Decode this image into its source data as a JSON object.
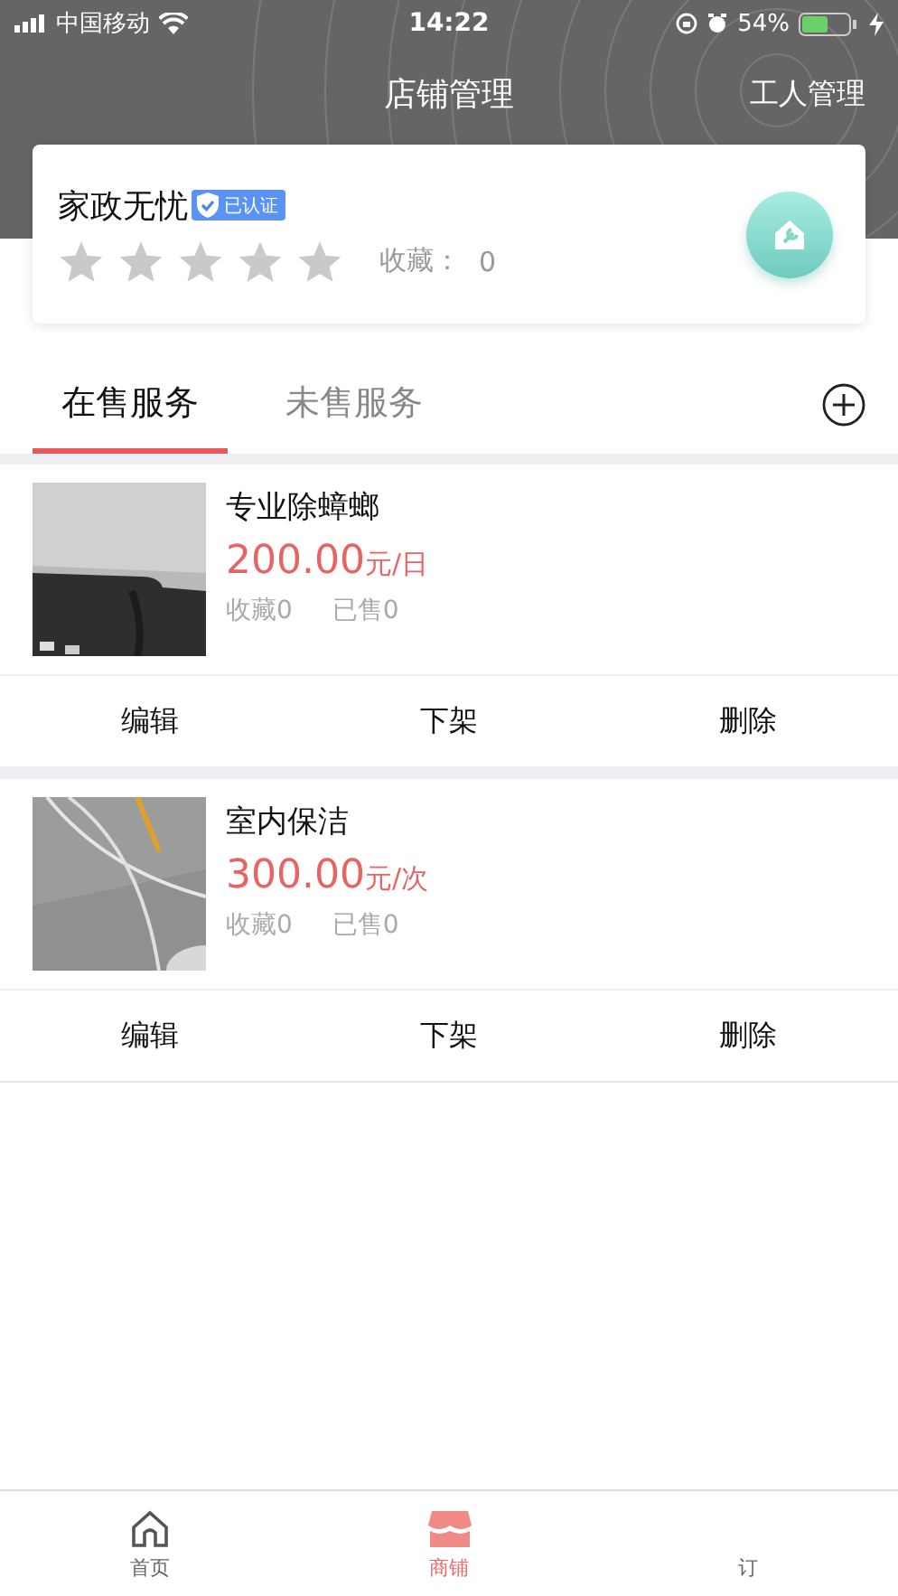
{
  "status_bar": {
    "carrier": "中国移动",
    "time": "14:22",
    "battery": "54%"
  },
  "header": {
    "title": "店铺管理",
    "action": "工人管理"
  },
  "shop": {
    "name": "家政无忧",
    "verified_label": "已认证",
    "stars": 0,
    "favorites_label": "收藏：",
    "favorites": "0"
  },
  "tabs": [
    {
      "label": "在售服务",
      "selected": true
    },
    {
      "label": "未售服务",
      "selected": false
    }
  ],
  "services": [
    {
      "title": "专业除蟑螂",
      "price": "200.00",
      "unit": "元/日",
      "favorites": "收藏0",
      "sold": "已售0",
      "actions": [
        "编辑",
        "下架",
        "删除"
      ]
    },
    {
      "title": "室内保洁",
      "price": "300.00",
      "unit": "元/次",
      "favorites": "收藏0",
      "sold": "已售0",
      "actions": [
        "编辑",
        "下架",
        "删除"
      ]
    }
  ],
  "bottom_nav": [
    {
      "label": "首页",
      "selected": false
    },
    {
      "label": "商铺",
      "selected": true
    },
    {
      "label": "订",
      "selected": false
    }
  ]
}
